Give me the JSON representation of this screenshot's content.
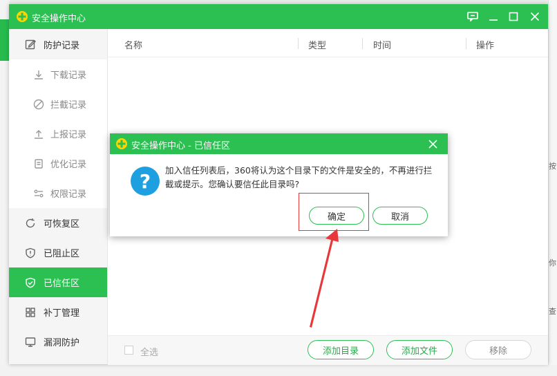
{
  "window": {
    "title": "安全操作中心"
  },
  "sidebar": {
    "items": [
      {
        "label": "防护记录",
        "icon": "edit-icon"
      },
      {
        "label": "下载记录",
        "icon": "download-icon"
      },
      {
        "label": "拦截记录",
        "icon": "block-icon"
      },
      {
        "label": "上报记录",
        "icon": "upload-icon"
      },
      {
        "label": "优化记录",
        "icon": "list-icon"
      },
      {
        "label": "权限记录",
        "icon": "toggle-icon"
      },
      {
        "label": "可恢复区",
        "icon": "restore-icon"
      },
      {
        "label": "已阻止区",
        "icon": "shield-alert-icon"
      },
      {
        "label": "已信任区",
        "icon": "shield-check-icon"
      },
      {
        "label": "补丁管理",
        "icon": "grid-icon"
      },
      {
        "label": "漏洞防护",
        "icon": "monitor-icon"
      }
    ],
    "active": "已信任区"
  },
  "table": {
    "columns": [
      "名称",
      "类型",
      "时间",
      "操作"
    ]
  },
  "footer": {
    "select_all": "全选",
    "add_dir": "添加目录",
    "add_file": "添加文件",
    "remove": "移除"
  },
  "dialog": {
    "title": "安全操作中心 - 已信任区",
    "message": "加入信任列表后，360将认为这个目录下的文件是安全的，不再进行拦截或提示。您确认要信任此目录吗?",
    "ok": "确定",
    "cancel": "取消"
  },
  "background": {
    "right_fragments": [
      "按",
      "你",
      "查"
    ]
  },
  "colors": {
    "brand_green": "#2cc052",
    "question_blue": "#1e9fe0",
    "annotation_red": "#e8373b"
  }
}
